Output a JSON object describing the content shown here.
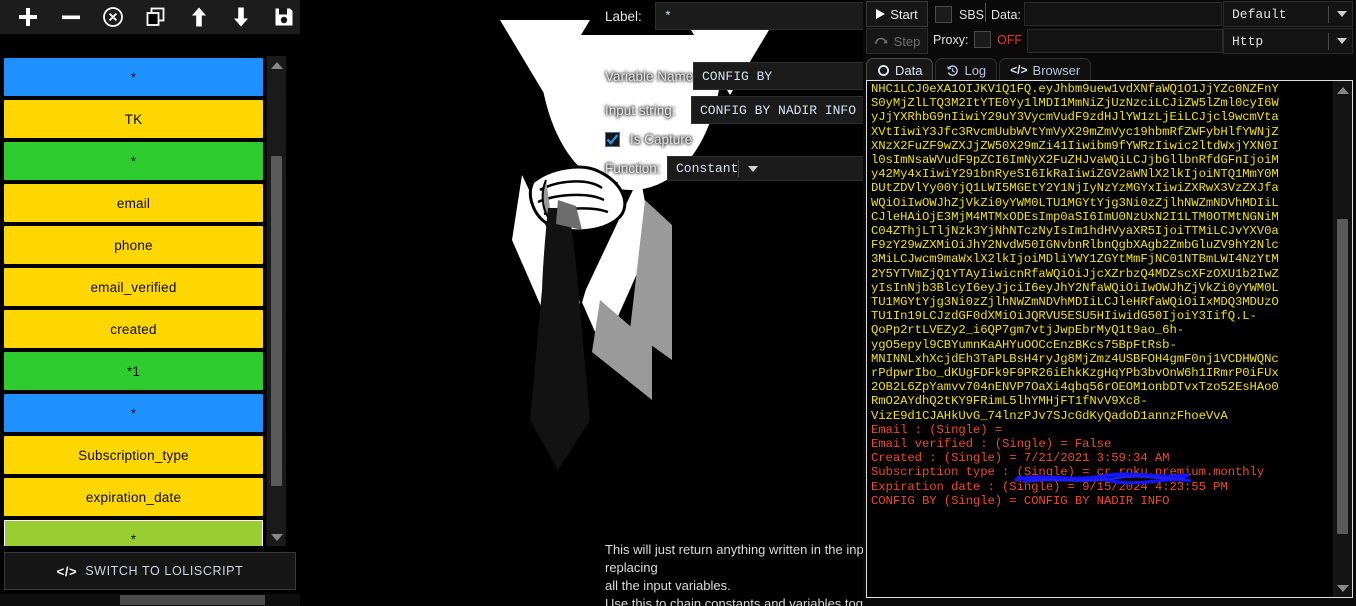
{
  "toolbar": {
    "buttons": [
      {
        "name": "add-block-button",
        "icon": "plus-icon"
      },
      {
        "name": "remove-block-button",
        "icon": "minus-icon"
      },
      {
        "name": "disable-block-button",
        "icon": "circle-x-icon"
      },
      {
        "name": "clone-block-button",
        "icon": "copy-icon"
      },
      {
        "name": "move-block-up-button",
        "icon": "arrow-up-icon"
      },
      {
        "name": "move-block-down-button",
        "icon": "arrow-down-icon"
      },
      {
        "name": "save-config-button",
        "icon": "floppy-save-icon"
      }
    ]
  },
  "blocks": [
    {
      "label": "*",
      "color": "#1E90FF"
    },
    {
      "label": "TK",
      "color": "#FFD700"
    },
    {
      "label": "*",
      "color": "#2ECC2E"
    },
    {
      "label": "email",
      "color": "#FFD700"
    },
    {
      "label": "phone",
      "color": "#FFD700"
    },
    {
      "label": "email_verified",
      "color": "#FFD700"
    },
    {
      "label": "created",
      "color": "#FFD700"
    },
    {
      "label": "*1",
      "color": "#2ECC2E"
    },
    {
      "label": "*",
      "color": "#1E90FF"
    },
    {
      "label": "Subscription_type",
      "color": "#FFD700"
    },
    {
      "label": "expiration_date",
      "color": "#FFD700"
    },
    {
      "label": "*",
      "color": "#9ACD32",
      "selected": true
    }
  ],
  "switch_button": {
    "label": "SWITCH TO LOLISCRIPT",
    "icon": "code-icon"
  },
  "block_editor": {
    "label_field": {
      "label": "Label:",
      "value": "*"
    },
    "variable_name_field": {
      "label": "Variable Name:",
      "value": "CONFIG BY"
    },
    "input_string_field": {
      "label": "Input string:",
      "value": "CONFIG BY NADIR INFO"
    },
    "is_capture": {
      "label": "Is Capture",
      "checked": true
    },
    "function_select": {
      "label": "Function:",
      "value": "Constant"
    },
    "help_text_line1": "This will just return anything written in the input string and store it in a variable, after possibly replacing",
    "help_text_line2": "all the input variables.",
    "help_text_line3": "Use this to chain constants and variables together."
  },
  "runner": {
    "start_label": "Start",
    "step_label": "Step",
    "sbs_label": "SBS",
    "sbs_checked": false,
    "data_label": "Data:",
    "data_value": "",
    "wordlist_type": "Default",
    "proxy_label": "Proxy:",
    "proxy_checked": false,
    "proxy_state": "OFF",
    "proxy_value": "",
    "proxy_type": "Http"
  },
  "tabs": [
    {
      "label": "Data",
      "icon": "circle-icon",
      "active": true
    },
    {
      "label": "Log",
      "icon": "history-icon",
      "active": false
    },
    {
      "label": "Browser",
      "icon": "code-icon",
      "active": false
    }
  ],
  "console": {
    "b64_lines": [
      "NHC1LCJ0eXA1OIJKV1Q1FQ.eyJhbm9uew1vdXNfaWQ1O1JjYZc0NZFnY",
      "S0yMjZlLTQ3M2ItYTE0Yy1lMDI1MmNiZjUzNzciLCJiZW5lZml0cyI6W",
      "yJjYXRhbG9nIiwiY29uY3VycmVudF9zdHJlYW1zLjEiLCJjcl9wcmVta",
      "XVtIiwiY3Jfc3RvcmUubWVtYmVyX29mZmVyc19hbmRfZWFybHlfYWNjZ",
      "XNzX2FuZF9wZXJjZW50X29mZi41Iiwibm9fYWRzIiwic2ltdWxjYXN0I",
      "l0sImNsaWVudF9pZCI6ImNyX2FuZHJvaWQiLCJjbGllbnRfdGFnIjoiM",
      "y42My4xIiwiY291bnRyeSI6IkRaIiwiZGV2aWNlX2lkIjoiNTQ1MmY0M",
      "DUtZDVlYy00YjQ1LWI5MGEtY2Y1NjIyNzYzMGYxIiwiZXRwX3VzZXJfa",
      "WQiOiIwOWJhZjVkZi0yYWM0LTU1MGYtYjg3Ni0zZjlhNWZmNDVhMDIiL",
      "CJleHAiOjE3MjM4MTMxODEsImp0aSI6ImU0NzUxN2I1LTM0OTMtNGNiM",
      "C04ZThjLTljNzk3YjNhNTczNyIsIm1hdHVyaXR5IjoiTTMiLCJvYXV0a",
      "F9zY29wZXMiOiJhY2NvdW50IGNvbnRlbnQgbXAgb2ZmbGluZV9hY2Nlc",
      "3MiLCJwcm9maWxlX2lkIjoiMDliYWY1ZGYtMmFjNC01NTBmLWI4NzYtM",
      "2Y5YTVmZjQ1YTAyIiwicnRfaWQiOiJjcXZrbzQ4MDZscXFzOXU1b2IwZ",
      "yIsInNjb3BlcyI6eyJjciI6eyJhY2NfaWQiOiIwOWJhZjVkZi0yYWM0L",
      "TU1MGYtYjg3Ni0zZjlhNWZmNDVhMDIiLCJleHRfaWQiOiIxMDQ3MDUzO",
      "TU1In19LCJzdGF0dXMiOiJQRVU5ESU5HIiwidG50IjoiY3IifQ.L-",
      "QoPp2rtLVEZy2_i6QP7gm7vtjJwpEbrMyQ1t9ao_6h-",
      "ygO5epyl9CBYumnKaAHYuOOCcEnzBKcs75BpFtRsb-",
      "MNINNLxhXcjdEh3TaPLBsH4ryJg8MjZmz4USBFOH4gmF0nj1VCDHWQNc",
      "rPdpwrIbo_dKUgFDFk9F9PR26iEhkKzgHqYPb3bvOnW6h1IRmrP0iFUx",
      "2OB2L6ZpYamvv704nENVP7OaXi4qbq56rOEOM1onbDTvxTzo52EsHAo0",
      "RmO2AYdhQ2tKY9FRimL5lhYMHjFT1fNvV9Xc8-",
      "VizE9d1CJAHkUvG_74lnzPJv7SJcGdKyQadoD1annzFhoeVvA"
    ],
    "result_lines": [
      "Email : (Single) = ",
      "Email verified : (Single) = False",
      "Created : (Single) = 7/21/2021 3:59:34 AM",
      "Subscription type : (Single) = cr.roku.premium.monthly",
      "Expiration date : (Single) = 9/15/2024 4:23:55 PM",
      "CONFIG BY (Single) = CONFIG BY NADIR INFO"
    ]
  }
}
